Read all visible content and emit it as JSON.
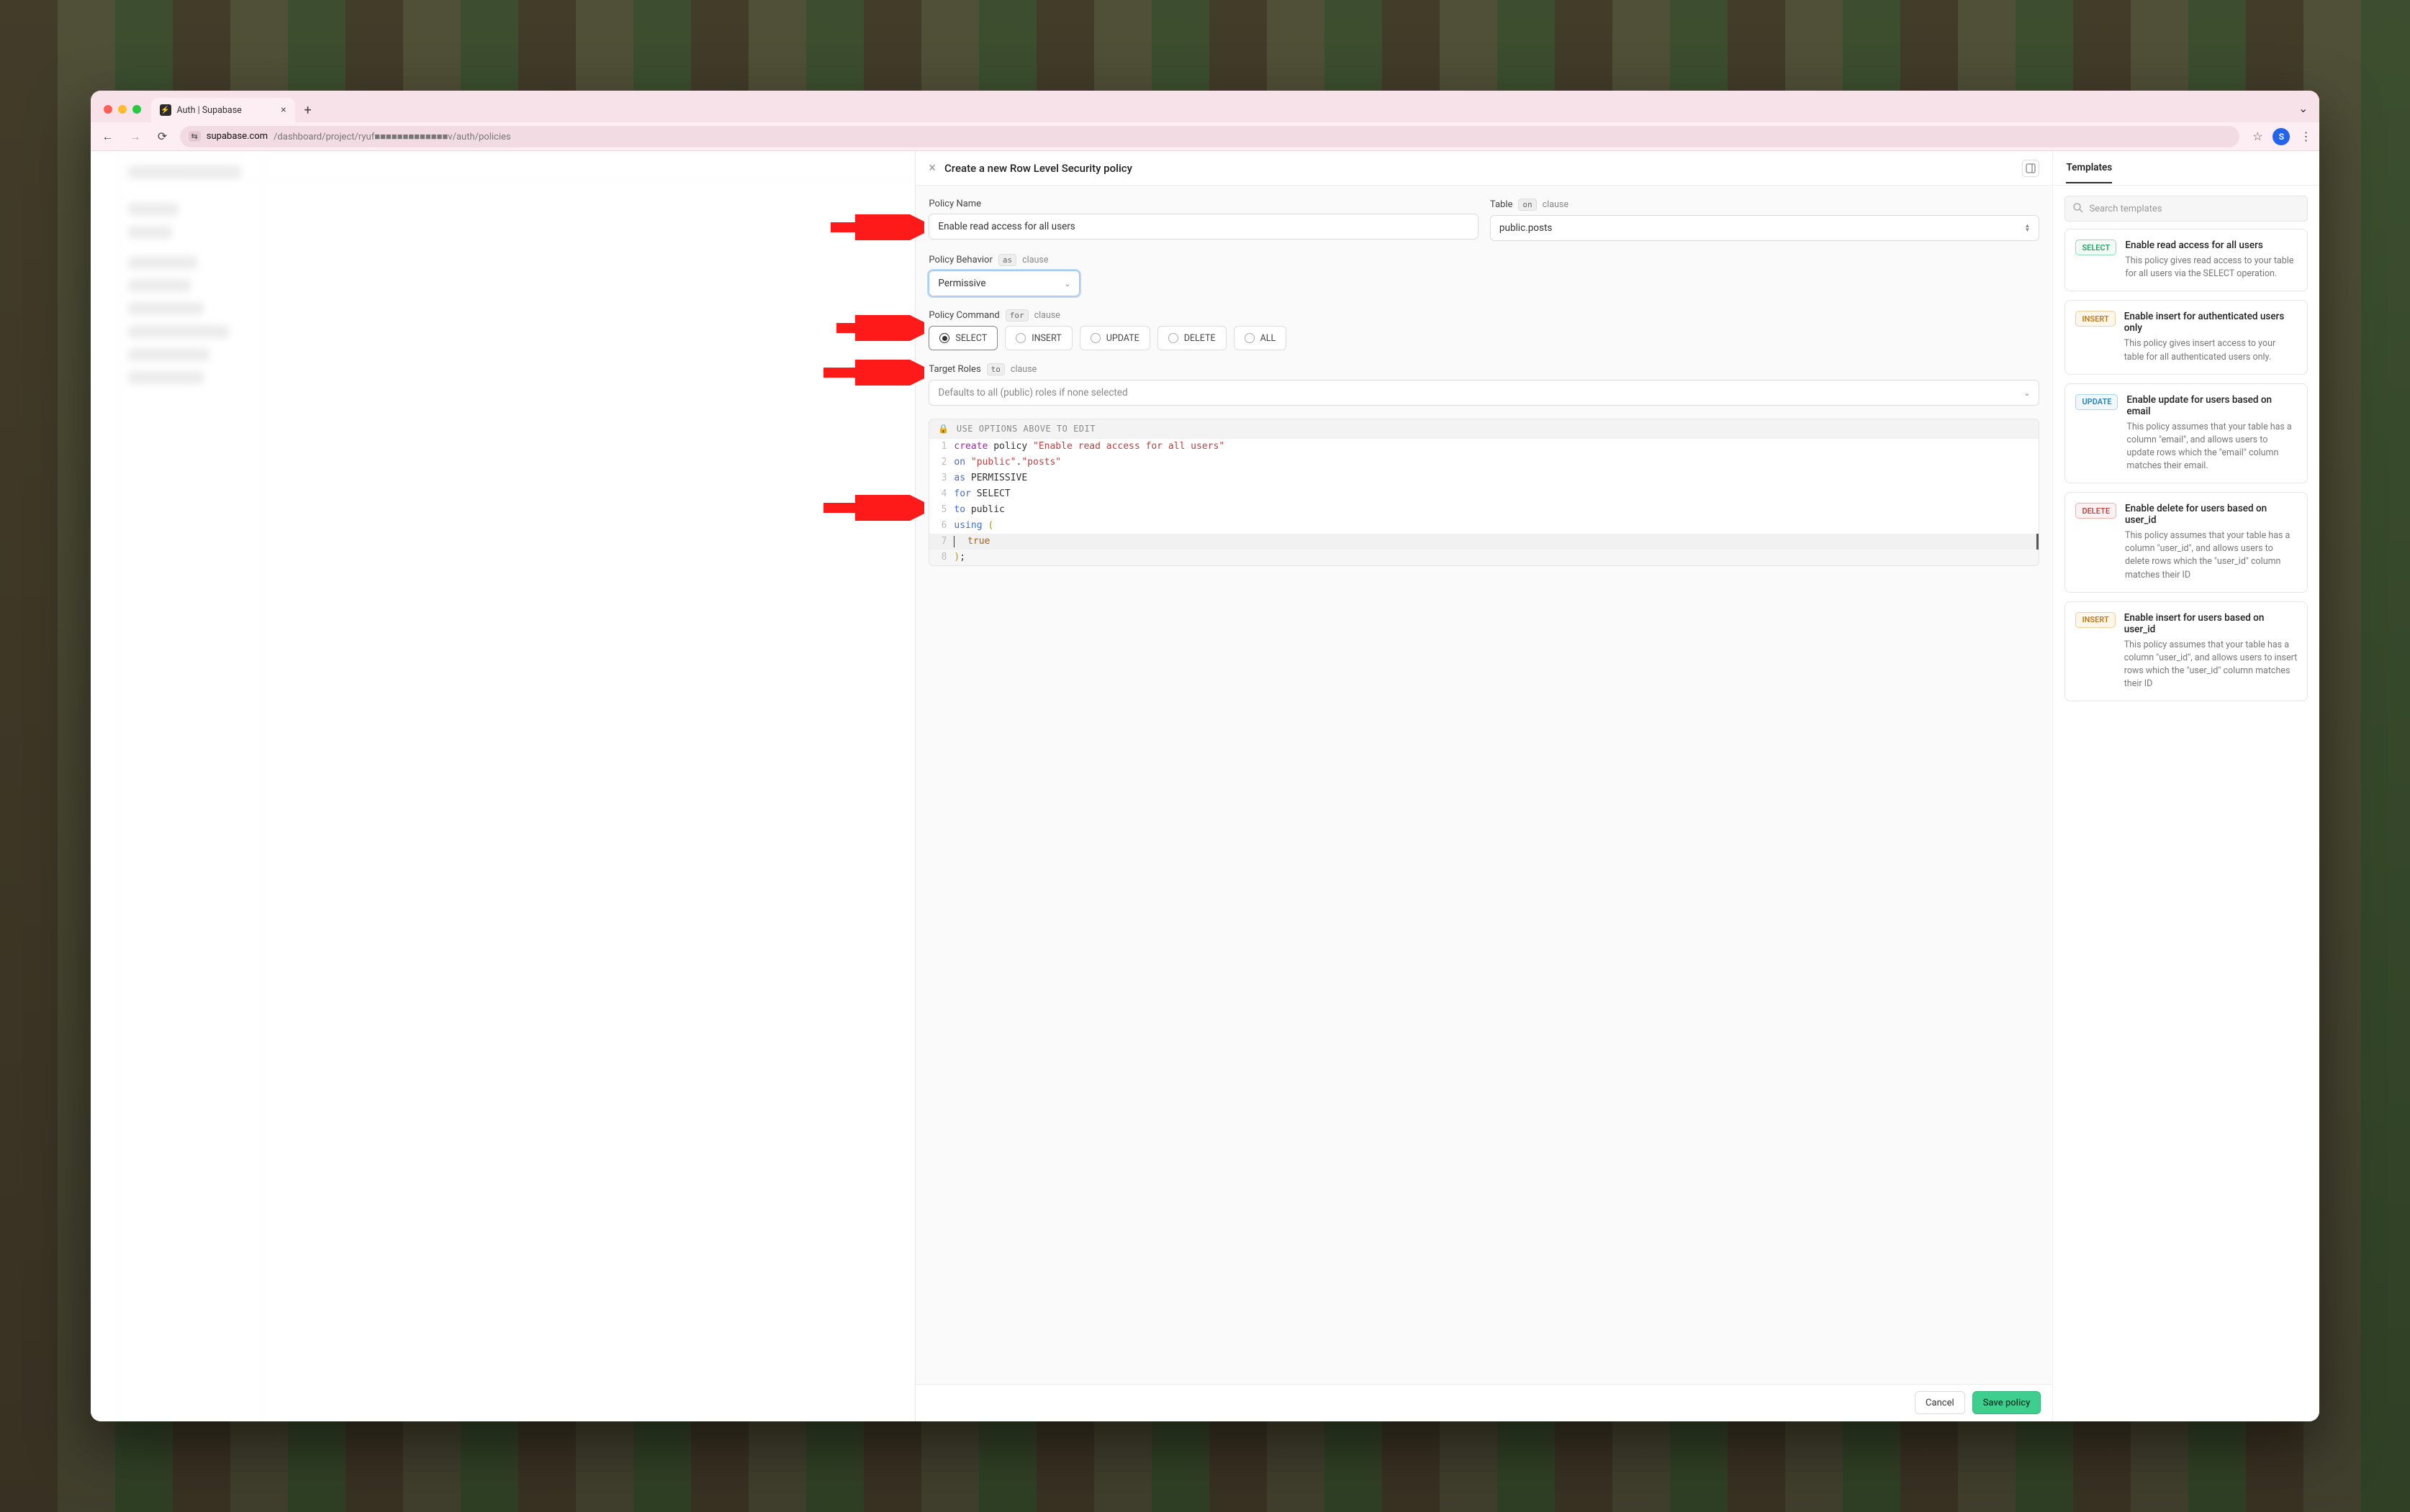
{
  "browser": {
    "tab_title": "Auth | Supabase",
    "url_host": "supabase.com",
    "url_path": "/dashboard/project/ryuf■■■■■■■■■■■■■v/auth/policies",
    "profile_initial": "S"
  },
  "modal": {
    "title": "Create a new Row Level Security policy",
    "policy_name": {
      "label": "Policy Name",
      "value": "Enable read access for all users"
    },
    "table": {
      "label": "Table",
      "chip": "on",
      "clause": "clause",
      "value": "public.posts"
    },
    "behavior": {
      "label": "Policy Behavior",
      "chip": "as",
      "clause": "clause",
      "value": "Permissive"
    },
    "command": {
      "label": "Policy Command",
      "chip": "for",
      "clause": "clause",
      "options": [
        "SELECT",
        "INSERT",
        "UPDATE",
        "DELETE",
        "ALL"
      ],
      "selected": "SELECT"
    },
    "roles": {
      "label": "Target Roles",
      "chip": "to",
      "clause": "clause",
      "placeholder": "Defaults to all (public) roles if none selected"
    },
    "code": {
      "banner": "USE OPTIONS ABOVE TO EDIT",
      "lines": [
        {
          "n": 1,
          "tokens": [
            {
              "t": "create",
              "c": "kw-purple"
            },
            {
              "t": " policy ",
              "c": ""
            },
            {
              "t": "\"Enable read access for all users\"",
              "c": "str"
            }
          ]
        },
        {
          "n": 2,
          "tokens": [
            {
              "t": "on",
              "c": "kw-blue"
            },
            {
              "t": " ",
              "c": ""
            },
            {
              "t": "\"public\"",
              "c": "str"
            },
            {
              "t": ".",
              "c": ""
            },
            {
              "t": "\"posts\"",
              "c": "str"
            }
          ]
        },
        {
          "n": 3,
          "tokens": [
            {
              "t": "as",
              "c": "kw-blue"
            },
            {
              "t": " PERMISSIVE",
              "c": ""
            }
          ]
        },
        {
          "n": 4,
          "tokens": [
            {
              "t": "for",
              "c": "kw-blue"
            },
            {
              "t": " SELECT",
              "c": ""
            }
          ]
        },
        {
          "n": 5,
          "tokens": [
            {
              "t": "to",
              "c": "kw-blue"
            },
            {
              "t": " public",
              "c": ""
            }
          ]
        },
        {
          "n": 6,
          "tokens": [
            {
              "t": "using",
              "c": "kw-blue"
            },
            {
              "t": " ",
              "c": ""
            },
            {
              "t": "(",
              "c": "punc"
            }
          ]
        },
        {
          "n": 7,
          "tokens": [
            {
              "t": "  ",
              "c": ""
            },
            {
              "t": "true",
              "c": "kw-orange"
            }
          ],
          "hl": "strong",
          "cursor": true
        },
        {
          "n": 8,
          "tokens": [
            {
              "t": ")",
              "c": "punc"
            },
            {
              "t": ";",
              "c": ""
            }
          ],
          "hl": "light"
        }
      ]
    },
    "footer": {
      "cancel": "Cancel",
      "save": "Save policy"
    }
  },
  "templates": {
    "title": "Templates",
    "search_placeholder": "Search templates",
    "items": [
      {
        "badge": "SELECT",
        "badge_cls": "badge-select",
        "title": "Enable read access for all users",
        "desc": "This policy gives read access to your table for all users via the SELECT operation."
      },
      {
        "badge": "INSERT",
        "badge_cls": "badge-insert",
        "title": "Enable insert for authenticated users only",
        "desc": "This policy gives insert access to your table for all authenticated users only."
      },
      {
        "badge": "UPDATE",
        "badge_cls": "badge-update",
        "title": "Enable update for users based on email",
        "desc": "This policy assumes that your table has a column \"email\", and allows users to update rows which the \"email\" column matches their email."
      },
      {
        "badge": "DELETE",
        "badge_cls": "badge-delete",
        "title": "Enable delete for users based on user_id",
        "desc": "This policy assumes that your table has a column \"user_id\", and allows users to delete rows which the \"user_id\" column matches their ID"
      },
      {
        "badge": "INSERT",
        "badge_cls": "badge-insert",
        "title": "Enable insert for users based on user_id",
        "desc": "This policy assumes that your table has a column \"user_id\", and allows users to insert rows which the \"user_id\" column matches their ID"
      }
    ]
  }
}
